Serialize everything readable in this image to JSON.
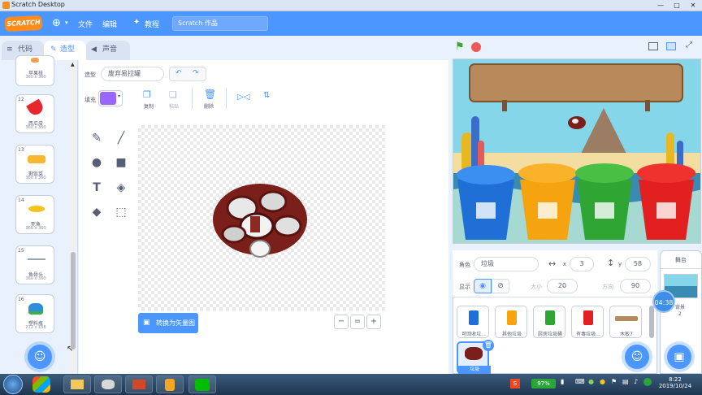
{
  "window": {
    "title": "Scratch Desktop"
  },
  "menubar": {
    "logo": "SCRATCH",
    "file": "文件",
    "edit": "编辑",
    "tutorial": "教程",
    "project_name": "Scratch 作品"
  },
  "tabs": {
    "code": "代码",
    "costumes": "造型",
    "sounds": "声音"
  },
  "costumes": [
    {
      "name": "苹果核",
      "size": "360 x 360"
    },
    {
      "num": "12",
      "name": "西瓜皮",
      "size": "360 x 360"
    },
    {
      "num": "13",
      "name": "剩饭菜",
      "size": "360 x 360"
    },
    {
      "num": "14",
      "name": "死鱼",
      "size": "360 x 360"
    },
    {
      "num": "15",
      "name": "鱼骨头",
      "size": "360 x 360"
    },
    {
      "num": "16",
      "name": "塑料瓶",
      "size": "212 x 158"
    }
  ],
  "editor": {
    "costume_label": "造型",
    "costume_name": "废弃易拉罐",
    "fill_label": "填充",
    "fill_color": "#9966ff",
    "copy": "复制",
    "paste": "粘贴",
    "delete": "删除",
    "convert_button": "转换为矢量图"
  },
  "sprite": {
    "label_sprite": "角色",
    "name": "垃圾",
    "x_label": "x",
    "x": "3",
    "y_label": "y",
    "y": "58",
    "show_label": "显示",
    "size_label": "大小",
    "size": "20",
    "direction_label": "方向",
    "direction": "90"
  },
  "sprites": [
    {
      "name": "可回收垃..."
    },
    {
      "name": "其他垃圾"
    },
    {
      "name": "厨房垃圾桶"
    },
    {
      "name": "有毒垃圾..."
    },
    {
      "name": "木板7"
    },
    {
      "name": "垃圾"
    }
  ],
  "stage_panel": {
    "title": "舞台",
    "backdrop_label": "背景",
    "backdrop_count": "2"
  },
  "timer": "04:38",
  "taskbar": {
    "battery": "97%",
    "time": "8:22",
    "date": "2019/10/24"
  },
  "colors": {
    "accent": "#4c97ff",
    "menubar": "#4c97ff"
  }
}
